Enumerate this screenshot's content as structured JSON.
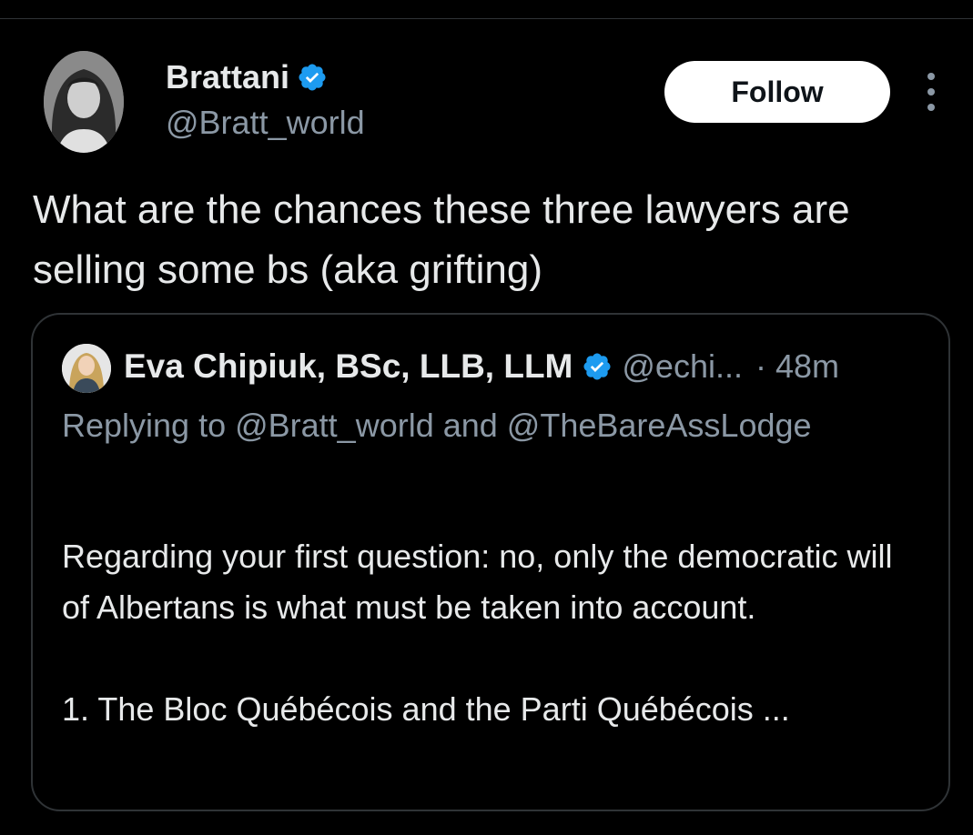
{
  "colors": {
    "background": "#000000",
    "text_primary": "#e7e9ea",
    "text_secondary": "#8b98a5",
    "verified_badge": "#1d9bf0",
    "follow_button_bg": "#ffffff",
    "border": "#2f3336"
  },
  "tweet": {
    "author": {
      "name": "Brattani",
      "handle": "@Bratt_world",
      "verified_icon": "verified-badge-icon"
    },
    "follow_label": "Follow",
    "more_icon": "more-options-icon",
    "text": "What are the chances these three lawyers are selling some bs (aka grifting)"
  },
  "quoted_tweet": {
    "author": {
      "name": "Eva Chipiuk, BSc, LLB, LLM",
      "handle": "@echi...",
      "verified_icon": "verified-badge-icon"
    },
    "separator": "·",
    "time": "48m",
    "replying_to": "Replying to @Bratt_world and @TheBareAssLodge",
    "body_paragraph_1": "Regarding your first question: no, only the democratic will of Albertans is what must be taken into account.",
    "body_paragraph_2": "1. The Bloc Québécois and the Parti Québécois ..."
  }
}
